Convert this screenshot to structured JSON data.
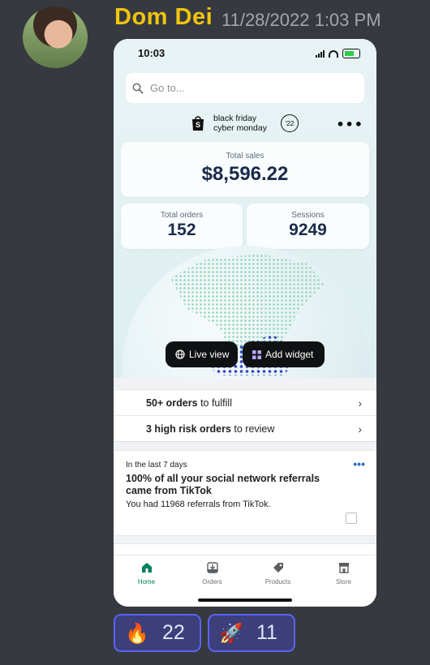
{
  "message": {
    "username": "Dom Dei",
    "timestamp": "11/28/2022 1:03 PM"
  },
  "phone": {
    "status_time": "10:03",
    "search_placeholder": "Go to...",
    "promo": {
      "line1": "black friday",
      "line2": "cyber monday",
      "badge": "'22"
    },
    "metrics": {
      "total_sales_label": "Total sales",
      "total_sales_value": "$8,596.22",
      "total_orders_label": "Total orders",
      "total_orders_value": "152",
      "sessions_label": "Sessions",
      "sessions_value": "9249"
    },
    "buttons": {
      "live_view": "Live view",
      "add_widget": "Add widget"
    },
    "tasks": [
      {
        "bold": "50+ orders",
        "rest": " to fulfill"
      },
      {
        "bold": "3 high risk orders",
        "rest": " to review"
      }
    ],
    "insight": {
      "period": "In the last 7 days",
      "title": "100% of all your social network referrals came from TikTok",
      "body": "You had 11968 referrals from TikTok."
    },
    "tabs": [
      {
        "label": "Home",
        "icon": "home-icon",
        "active": true
      },
      {
        "label": "Orders",
        "icon": "orders-icon",
        "active": false
      },
      {
        "label": "Products",
        "icon": "products-icon",
        "active": false
      },
      {
        "label": "Store",
        "icon": "store-icon",
        "active": false
      }
    ]
  },
  "reactions": [
    {
      "emoji": "🔥",
      "icon": "fire-icon",
      "count": "22"
    },
    {
      "emoji": "🚀",
      "icon": "rocket-icon",
      "count": "11"
    }
  ],
  "colors": {
    "username": "#f1c40f",
    "accent": "#5865f2",
    "shopify_green": "#008060"
  }
}
